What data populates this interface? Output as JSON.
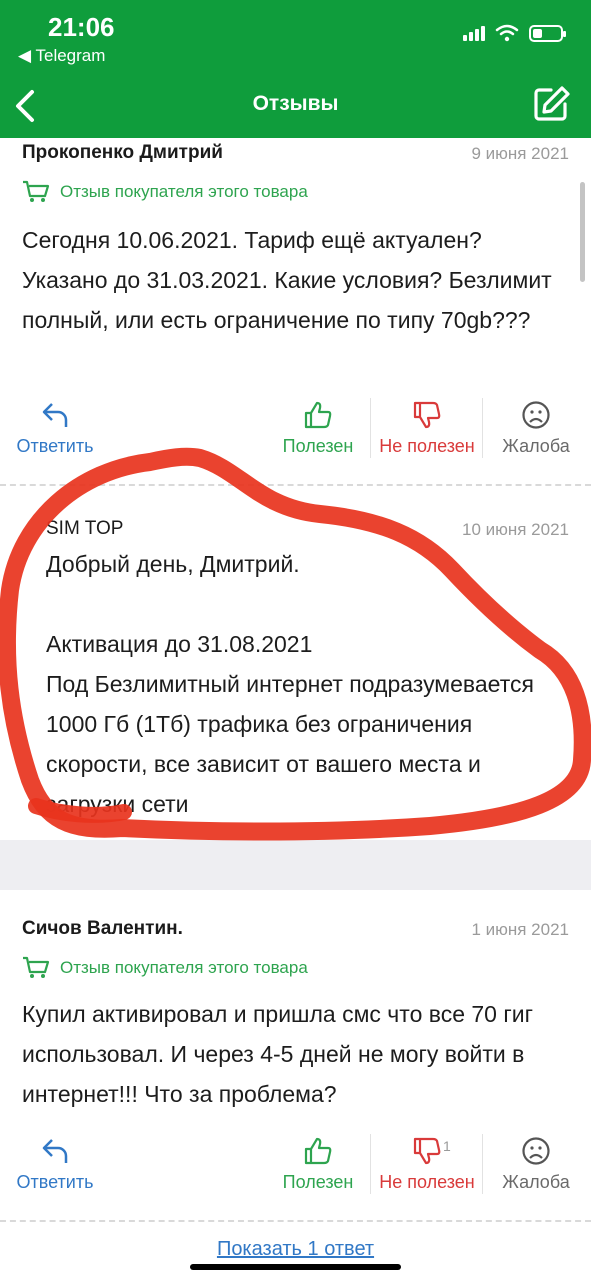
{
  "status_bar": {
    "time": "21:06",
    "back_app": "◀ Telegram",
    "battery_level": 0.35
  },
  "nav": {
    "title": "Отзывы",
    "back_icon": "chevron-left-icon",
    "edit_icon": "edit-icon"
  },
  "reviews": [
    {
      "author": "Прокопенко Дмитрий",
      "date": "9 июня 2021",
      "buyer_label": "Отзыв покупателя этого товара",
      "text": "Сегодня 10.06.2021. Тариф ещё актуален? Указано до 31.03.2021. Какие условия? Безлимит полный, или есть ограничение по типу 70gb???",
      "actions": {
        "answer": "Ответить",
        "useful": "Полезен",
        "not_useful": "Не полезен",
        "complain": "Жалоба"
      },
      "reply": {
        "author": "SIM TOP",
        "date": "10 июня 2021",
        "text": "Добрый день, Дмитрий.\n\nАктивация до 31.08.2021\nПод Безлимитный интернет подразумевается 1000 Гб (1Тб) трафика без ограничения скорости, все зависит от вашего места и загрузки сети"
      }
    },
    {
      "author": "Сичов Валентин.",
      "date": "1 июня 2021",
      "buyer_label": "Отзыв покупателя этого товара",
      "text": "Купил активировал и пришла смс что все 70 гиг использовал. И через 4-5 дней не могу войти в интернет!!! Что за проблема?",
      "actions": {
        "answer": "Ответить",
        "useful": "Полезен",
        "not_useful": "Не полезен",
        "complain": "Жалоба",
        "not_useful_count": "1"
      },
      "show_replies": "Показать 1 ответ"
    }
  ],
  "colors": {
    "brand": "#0f9d3c",
    "link": "#3178c6",
    "useful": "#2ea44f",
    "not_useful": "#d93a3a",
    "annotation": "#e8331d"
  }
}
